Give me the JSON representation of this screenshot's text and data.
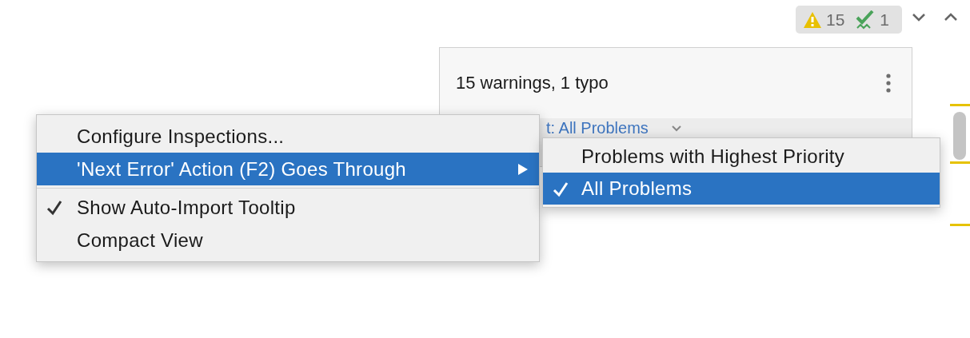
{
  "toolbar": {
    "warnings": "15",
    "typos": "1"
  },
  "panel": {
    "summary": "15 warnings, 1 typo",
    "filter": "t: All Problems"
  },
  "menu": {
    "items": [
      {
        "kind": "item",
        "label": "Configure Inspections...",
        "selected": false,
        "checked": false
      },
      {
        "kind": "submenu",
        "label": "'Next Error' Action (F2) Goes Through",
        "selected": true,
        "checked": false
      },
      {
        "kind": "separator"
      },
      {
        "kind": "item",
        "label": "Show Auto-Import Tooltip",
        "selected": false,
        "checked": true
      },
      {
        "kind": "item",
        "label": "Compact View",
        "selected": false,
        "checked": false
      }
    ]
  },
  "submenu": {
    "items": [
      {
        "label": "Problems with Highest Priority",
        "selected": false,
        "checked": false
      },
      {
        "label": "All Problems",
        "selected": true,
        "checked": true
      }
    ]
  }
}
